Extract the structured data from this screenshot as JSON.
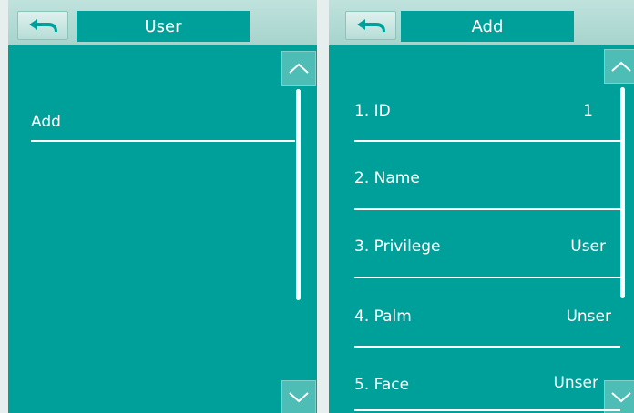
{
  "left_screen": {
    "title": "User",
    "items": [
      {
        "label": "Add"
      }
    ]
  },
  "right_screen": {
    "title": "Add",
    "fields": [
      {
        "label": "1. ID",
        "value": "1"
      },
      {
        "label": "2. Name",
        "value": ""
      },
      {
        "label": "3. Privilege",
        "value": "User"
      },
      {
        "label": "4. Palm",
        "value": "Unser"
      },
      {
        "label": "5. Face",
        "value": "Unser"
      }
    ]
  },
  "icons": {
    "back": "back-arrow-icon",
    "scroll_up": "chevron-up-icon",
    "scroll_down": "chevron-down-icon"
  },
  "colors": {
    "background": "#00a09a",
    "header": "#b2dad3",
    "text": "#ffffff"
  }
}
